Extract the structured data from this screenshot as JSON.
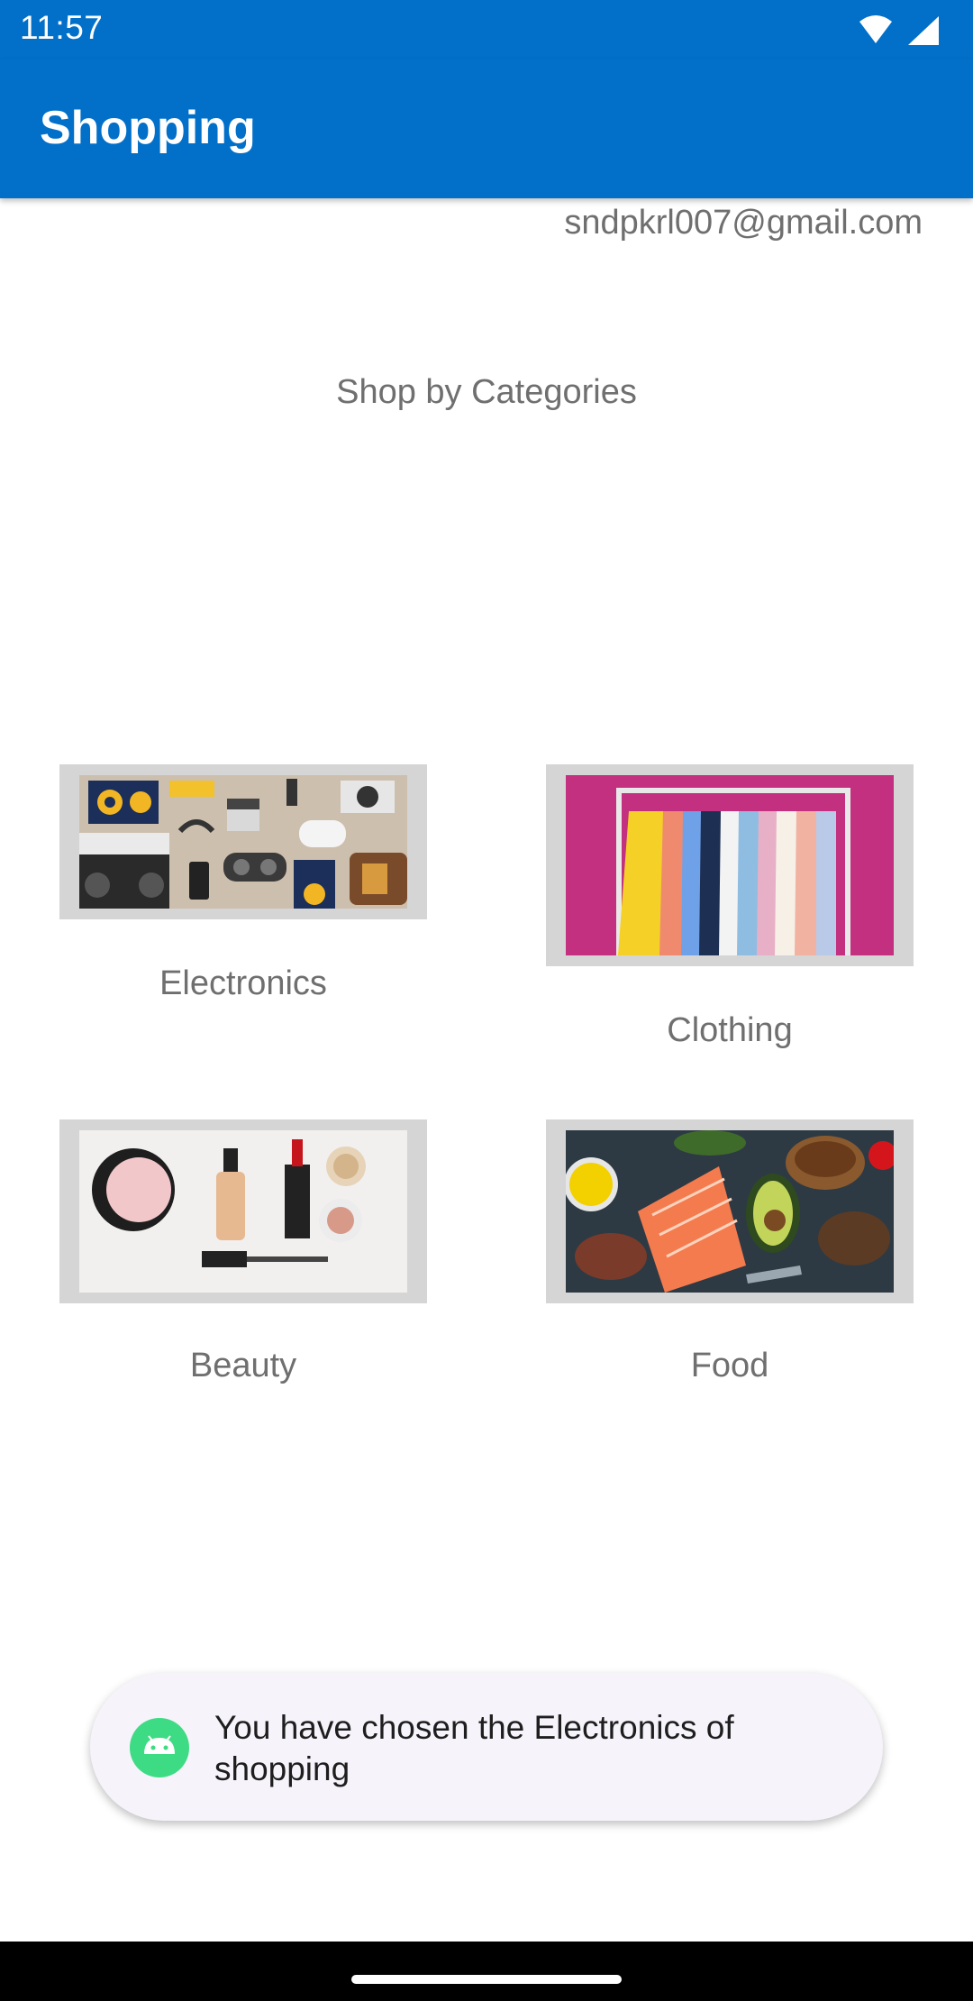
{
  "status_bar": {
    "time": "11:57",
    "icons": [
      "wifi-icon",
      "signal-icon"
    ]
  },
  "app_bar": {
    "title": "Shopping"
  },
  "user": {
    "email": "sndpkrl007@gmail.com"
  },
  "section": {
    "title": "Shop by Categories"
  },
  "categories": [
    {
      "label": "Electronics"
    },
    {
      "label": "Clothing"
    },
    {
      "label": "Beauty"
    },
    {
      "label": "Food"
    }
  ],
  "toast": {
    "message": "You have chosen the Electronics of shopping",
    "icon": "android-icon"
  },
  "colors": {
    "primary": "#0270c9",
    "card_frame": "#d5d5d5",
    "label_gray": "#6f6f6f",
    "toast_bg": "#f6f3fa"
  }
}
